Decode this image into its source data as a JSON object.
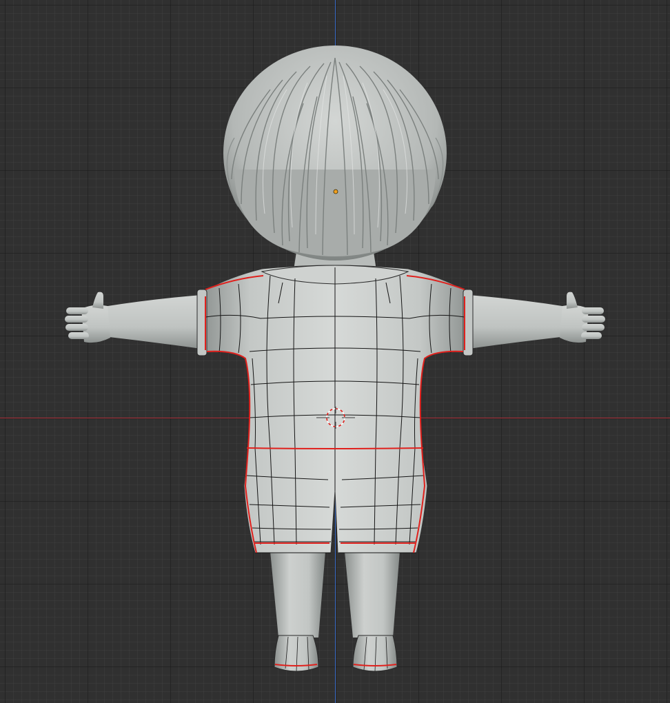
{
  "viewport": {
    "background": "#303030",
    "grid_minor_color": "#3a3a3a",
    "grid_major_color": "#262626"
  },
  "axes": {
    "x_axis_color": "#b0323c",
    "z_axis_color": "#3a6cc8"
  },
  "model": {
    "body_color": "#c8cbc9",
    "shade_color": "#8e9391",
    "wire_color": "#1a1a1a",
    "seam_color": "#e0201c"
  },
  "origin_point_color": "#f0a020",
  "cursor_colors": [
    "#e0201c",
    "#ffffff"
  ]
}
